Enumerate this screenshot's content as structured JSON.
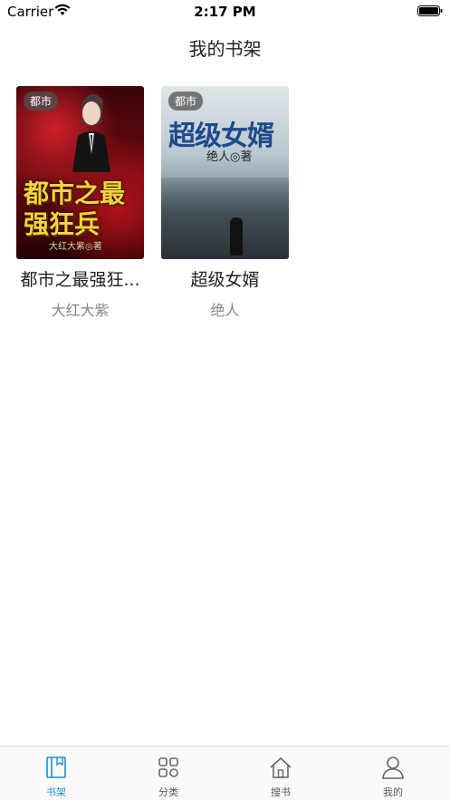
{
  "status_bar": {
    "carrier": "Carrier",
    "time": "2:17 PM"
  },
  "nav": {
    "title": "我的书架"
  },
  "books": [
    {
      "tag": "都市",
      "cover_title": "都市之最强狂兵",
      "cover_author": "大红大紫◎著",
      "title": "都市之最强狂...",
      "author": "大红大紫"
    },
    {
      "tag": "都市",
      "cover_title": "超级女婿",
      "cover_author": "绝人◎著",
      "title": "超级女婿",
      "author": "绝人"
    }
  ],
  "tabs": [
    {
      "label": "书架",
      "icon": "book-icon",
      "active": true
    },
    {
      "label": "分类",
      "icon": "grid-icon",
      "active": false
    },
    {
      "label": "搜书",
      "icon": "home-icon",
      "active": false
    },
    {
      "label": "我的",
      "icon": "person-icon",
      "active": false
    }
  ],
  "colors": {
    "accent": "#1a8fd6",
    "tab_inactive": "#555555",
    "title_text": "#222222",
    "author_text": "#888888"
  }
}
